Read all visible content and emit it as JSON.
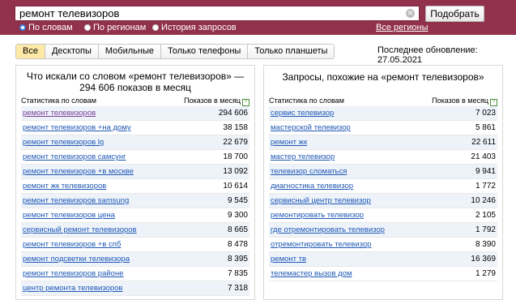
{
  "search": {
    "value": "ремонт телевизоров",
    "clear_icon": "close-icon",
    "submit_label": "Подобрать"
  },
  "modes": [
    {
      "label": "По словам",
      "selected": true
    },
    {
      "label": "По регионам",
      "selected": false
    },
    {
      "label": "История запросов",
      "selected": false
    }
  ],
  "regions_link": "Все регионы",
  "tabs": [
    "Все",
    "Десктопы",
    "Мобильные",
    "Только телефоны",
    "Только планшеты"
  ],
  "updated": "Последнее обновление: 27.05.2021",
  "left": {
    "title": "Что искали со словом «ремонт телевизоров» — 294 606 показов в месяц",
    "col_stat": "Статистика по словам",
    "col_views": "Показов в месяц",
    "help_icon": "?",
    "rows": [
      {
        "q": "ремонт телевизоров",
        "v": "294 606"
      },
      {
        "q": "ремонт телевизоров +на дому",
        "v": "38 158"
      },
      {
        "q": "ремонт телевизоров lg",
        "v": "22 679"
      },
      {
        "q": "ремонт телевизоров самсунг",
        "v": "18 700"
      },
      {
        "q": "ремонт телевизоров +в москве",
        "v": "13 092"
      },
      {
        "q": "ремонт жк телевизоров",
        "v": "10 614"
      },
      {
        "q": "ремонт телевизоров samsung",
        "v": "9 545"
      },
      {
        "q": "ремонт телевизоров цена",
        "v": "9 300"
      },
      {
        "q": "сервисный ремонт телевизоров",
        "v": "8 665"
      },
      {
        "q": "ремонт телевизоров +в спб",
        "v": "8 478"
      },
      {
        "q": "ремонт подсветки телевизора",
        "v": "8 395"
      },
      {
        "q": "ремонт телевизоров районе",
        "v": "7 835"
      },
      {
        "q": "центр ремонта телевизоров",
        "v": "7 318"
      }
    ]
  },
  "right": {
    "title": "Запросы, похожие на «ремонт телевизоров»",
    "col_stat": "Статистика по словам",
    "col_views": "Показов в месяц",
    "help_icon": "?",
    "rows": [
      {
        "q": "сервис телевизор",
        "v": "7 023"
      },
      {
        "q": "мастерской телевизор",
        "v": "5 861"
      },
      {
        "q": "ремонт жк",
        "v": "22 611"
      },
      {
        "q": "мастер телевизор",
        "v": "21 403"
      },
      {
        "q": "телевизор сломаться",
        "v": "9 941"
      },
      {
        "q": "диагностика телевизор",
        "v": "1 772"
      },
      {
        "q": "сервисный центр телевизор",
        "v": "10 246"
      },
      {
        "q": "ремонтировать телевизор",
        "v": "2 105"
      },
      {
        "q": "где отремонтировать телевизор",
        "v": "1 792"
      },
      {
        "q": "отремонтировать телевизор",
        "v": "8 390"
      },
      {
        "q": "ремонт тв",
        "v": "16 369"
      },
      {
        "q": "телемастер вызов дом",
        "v": "1 279"
      }
    ]
  }
}
